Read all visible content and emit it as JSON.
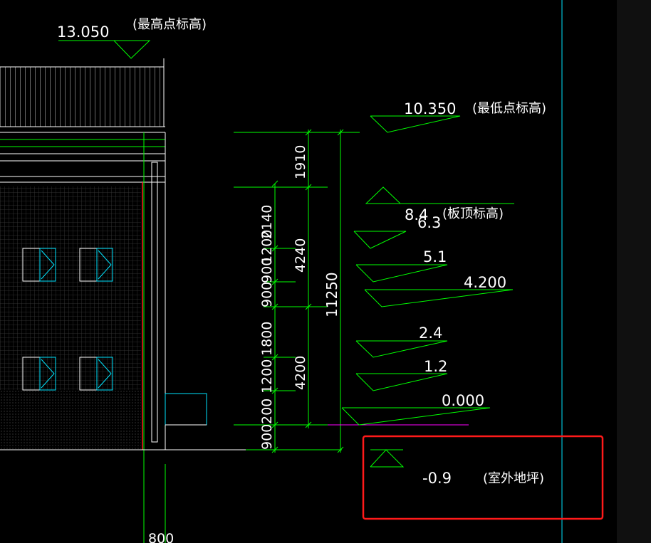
{
  "colors": {
    "background": "#000000",
    "dimension_line": "#00ff00",
    "text": "#ffffff",
    "guide_line": "#00e5ff",
    "red_axis": "#ff2020",
    "magenta_line": "#ff00ff",
    "highlight_box": "#ff1a1a",
    "right_strip": "#111111"
  },
  "elevation_marks": {
    "top": {
      "value": "13.050",
      "note": "(最高点标高)"
    },
    "low_roof": {
      "value": "10.350",
      "note": "(最低点标高)"
    },
    "slab_top": {
      "value": "8.4",
      "overlap": "6.3",
      "note": "(板顶标高)"
    },
    "level_51": {
      "value": "5.1"
    },
    "level_42": {
      "value": "4.200"
    },
    "level_24": {
      "value": "2.4"
    },
    "level_12": {
      "value": "1.2"
    },
    "ground_floor": {
      "value": "0.000"
    },
    "outdoor": {
      "value": "-0.9",
      "note": "(室外地坪)"
    }
  },
  "dimensions": {
    "segments": [
      "900",
      "200",
      "1200",
      "1800",
      "900",
      "900",
      "1200",
      "2140"
    ],
    "floors": [
      "4200",
      "4240",
      "1910"
    ],
    "total": "11250",
    "bottom": "800"
  }
}
